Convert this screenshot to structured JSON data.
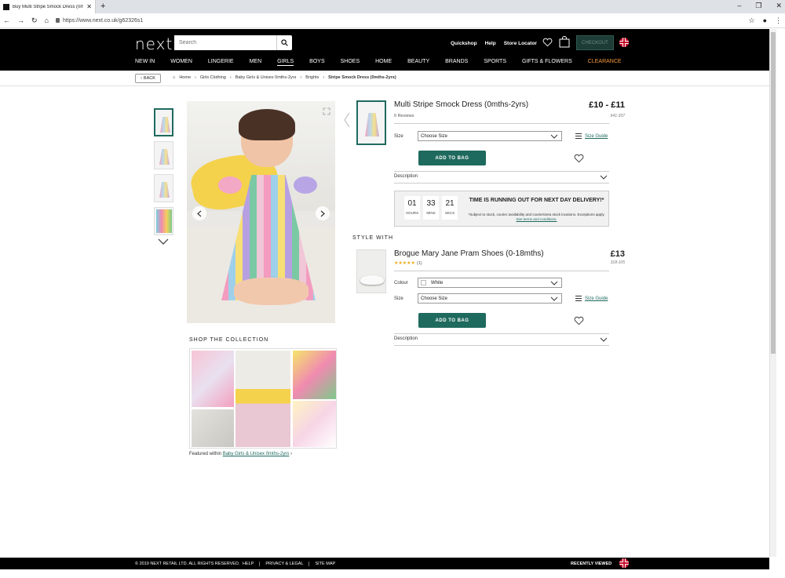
{
  "browser": {
    "tab_title": "Buy Multi Stripe Smock Dress (0m",
    "url": "https://www.next.co.uk/g62326s1"
  },
  "header": {
    "logo": "next",
    "search_placeholder": "Search",
    "links": [
      "Quickshop",
      "Help",
      "Store Locator"
    ],
    "checkout_label": "CHECKOUT",
    "nav": [
      "NEW IN",
      "WOMEN",
      "LINGERIE",
      "MEN",
      "GIRLS",
      "BOYS",
      "SHOES",
      "HOME",
      "BEAUTY",
      "BRANDS",
      "SPORTS",
      "GIFTS & FLOWERS",
      "CLEARANCE"
    ],
    "active_nav": "GIRLS"
  },
  "breadcrumb": {
    "back_label": "BACK",
    "items": [
      "Home",
      "Girls Clothing",
      "Baby Girls & Unisex 0mths-2yrs",
      "Brights"
    ],
    "current": "Stripe Smock Dress (0mths-2yrs)"
  },
  "collection": {
    "title": "SHOP THE COLLECTION",
    "featured_prefix": "Featured within",
    "featured_link": "Baby Girls & Unisex 0mths-2yrs"
  },
  "product": {
    "title": "Multi Stripe Smock Dress (0mths-2yrs)",
    "price": "£10 - £11",
    "reviews": "0 Reviews",
    "sku": "641-337",
    "size_label": "Size",
    "size_placeholder": "Choose Size",
    "size_guide": "Size Guide",
    "add_to_bag": "ADD TO BAG",
    "description_label": "Description"
  },
  "countdown": {
    "hours": "01",
    "mins": "33",
    "secs": "21",
    "hours_label": "HOURS",
    "mins_label": "MINS",
    "secs_label": "SECS",
    "title": "TIME IS RUNNING OUT FOR NEXT DAY DELIVERY!*",
    "note": "*Subject to stock, courier availability and courier/area stock locations. Exceptions apply.",
    "note_link": "See terms and conditions."
  },
  "style_with": {
    "title": "STYLE WITH",
    "product_title": "Brogue Mary Jane Pram Shoes (0-18mths)",
    "price": "£13",
    "stars": "★★★★★",
    "rating_count": "(1)",
    "sku": "318-105",
    "colour_label": "Colour",
    "colour_value": "White",
    "size_label": "Size",
    "size_placeholder": "Choose Size",
    "size_guide": "Size Guide",
    "add_to_bag": "ADD TO BAG",
    "description_label": "Description"
  },
  "footer": {
    "copyright": "© 2019 NEXT RETAIL LTD. ALL RIGHTS RESERVED.",
    "links": [
      "HELP",
      "PRIVACY & LEGAL",
      "SITE MAP"
    ],
    "recently_viewed": "RECENTLY VIEWED"
  },
  "colors": {
    "accent": "#1f6a5e",
    "header_bg": "#000000",
    "clearance": "#f89a3b"
  }
}
